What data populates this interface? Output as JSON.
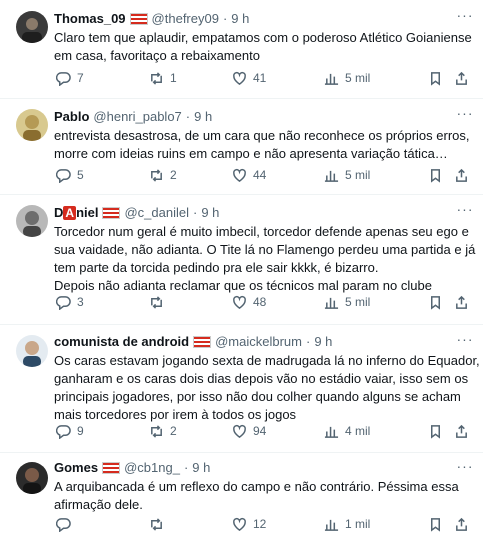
{
  "tweets": [
    {
      "name": "Thomas_09",
      "handle": "@thefrey09",
      "time": "9 h",
      "lines": [
        "Claro tem que aplaudir, empatamos com o poderoso Atlético Goianiense",
        "em casa, favoritaço a rebaixamento"
      ],
      "replies": "7",
      "retweets": "1",
      "likes": "41",
      "views": "5 mil",
      "avatar_color": "#3a3a3a"
    },
    {
      "name": "Pablo",
      "handle": "@henri_pablo7",
      "time": "9 h",
      "lines": [
        "entrevista desastrosa, de um cara que não reconhece os próprios erros,",
        "morre com ideias ruins em campo e não apresenta variação tática…"
      ],
      "replies": "5",
      "retweets": "2",
      "likes": "44",
      "views": "5 mil",
      "avatar_color": "#b59a55"
    },
    {
      "name_prefix": "D",
      "name_badge": "A",
      "name_suffix": "niel",
      "handle": "@c_danilel",
      "time": "9 h",
      "lines": [
        "Torcedor num geral é muito imbecil, torcedor defende apenas seu ego e",
        "sua vaidade, não adianta. O Tite lá no Flamengo perdeu uma partida e já",
        "tem parte da torcida pedindo pra ele sair kkkk, é bizarro.",
        "Depois não adianta reclamar que os técnicos mal param no clube"
      ],
      "replies": "3",
      "retweets": "",
      "likes": "48",
      "views": "5 mil",
      "avatar_color": "#6d6d6d"
    },
    {
      "name": "comunista de android",
      "handle": "@maickelbrum",
      "time": "9 h",
      "lines": [
        "Os caras estavam jogando sexta de madrugada lá no inferno do Equador,",
        "ganharam e os caras dois dias depois vão no estádio vaiar, isso sem os",
        "principais jogadores, por isso não dou colher quando alguns se acham",
        "mais torcedores por irem à todos os jogos"
      ],
      "replies": "9",
      "retweets": "2",
      "likes": "94",
      "views": "4 mil",
      "avatar_color": "#c9d3dc"
    },
    {
      "name": "Gomes",
      "handle": "@cb1ng_",
      "time": "9 h",
      "lines": [
        "A arquibancada é um reflexo do campo e não contrário. Péssima essa",
        "afirmação dele."
      ],
      "replies": "",
      "retweets": "",
      "likes": "12",
      "views": "1 mil",
      "avatar_color": "#2b2b2b"
    }
  ],
  "more_glyph": "···"
}
